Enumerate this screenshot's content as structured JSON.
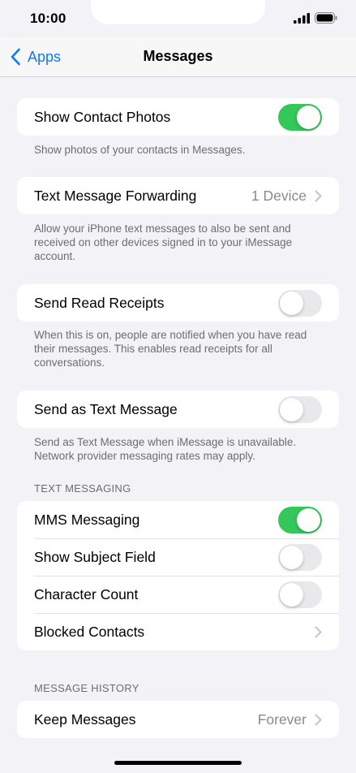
{
  "status_bar": {
    "time": "10:00"
  },
  "nav": {
    "back_label": "Apps",
    "title": "Messages"
  },
  "groups": {
    "contact_photos": {
      "label": "Show Contact Photos",
      "on": true,
      "footer": "Show photos of your contacts in Messages."
    },
    "forwarding": {
      "label": "Text Message Forwarding",
      "value": "1 Device",
      "footer": "Allow your iPhone text messages to also be sent and received on other devices signed in to your iMessage account."
    },
    "read_receipts": {
      "label": "Send Read Receipts",
      "on": false,
      "footer": "When this is on, people are notified when you have read their messages. This enables read receipts for all conversations."
    },
    "send_as_text": {
      "label": "Send as Text Message",
      "on": false,
      "footer": "Send as Text Message when iMessage is unavailable. Network provider messaging rates may apply."
    },
    "text_messaging": {
      "header": "TEXT MESSAGING",
      "mms": {
        "label": "MMS Messaging",
        "on": true
      },
      "subject": {
        "label": "Show Subject Field",
        "on": false
      },
      "char_count": {
        "label": "Character Count",
        "on": false
      },
      "blocked": {
        "label": "Blocked Contacts"
      }
    },
    "history": {
      "header": "MESSAGE HISTORY",
      "keep": {
        "label": "Keep Messages",
        "value": "Forever"
      }
    }
  },
  "colors": {
    "accent": "#0a7aff",
    "toggle_on": "#34c759",
    "toggle_off": "#e9e9eb",
    "background": "#f2f2f7"
  }
}
